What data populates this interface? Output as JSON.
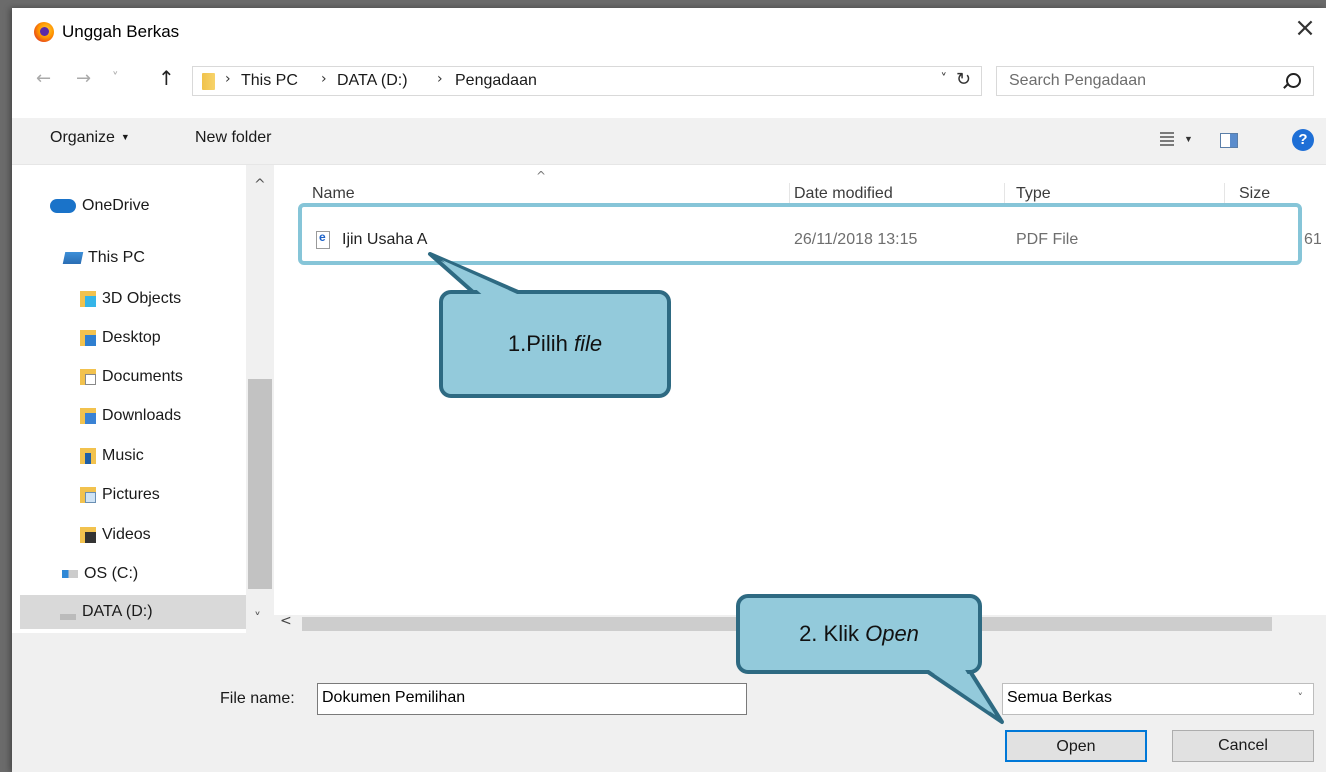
{
  "window": {
    "title": "Unggah Berkas",
    "close_label": "×"
  },
  "nav": {
    "back_label": "←",
    "forward_label": "→",
    "history_label": "˅",
    "up_label": "↑",
    "breadcrumb": [
      "This PC",
      "DATA (D:)",
      "Pengadaan"
    ],
    "separator": "›",
    "dropdown_label": "˅",
    "refresh_label": "↻"
  },
  "search": {
    "placeholder": "Search Pengadaan"
  },
  "toolbar": {
    "organize_label": "Organize",
    "organize_caret": "▼",
    "new_folder_label": "New folder",
    "view_caret": "▼",
    "help_label": "?"
  },
  "sidebar": {
    "items": [
      {
        "label": "OneDrive",
        "icon": "onedrive-icon"
      },
      {
        "label": "This PC",
        "icon": "pc-icon"
      },
      {
        "label": "3D Objects",
        "icon": "folder-3d-icon"
      },
      {
        "label": "Desktop",
        "icon": "folder-desktop-icon"
      },
      {
        "label": "Documents",
        "icon": "folder-documents-icon"
      },
      {
        "label": "Downloads",
        "icon": "folder-downloads-icon"
      },
      {
        "label": "Music",
        "icon": "folder-music-icon"
      },
      {
        "label": "Pictures",
        "icon": "folder-pictures-icon"
      },
      {
        "label": "Videos",
        "icon": "folder-videos-icon"
      },
      {
        "label": "OS (C:)",
        "icon": "drive-os-icon"
      },
      {
        "label": "DATA (D:)",
        "icon": "drive-data-icon",
        "selected": true
      }
    ],
    "scroll_up": "^",
    "scroll_down": "˅"
  },
  "columns": {
    "name": "Name",
    "date": "Date modified",
    "type": "Type",
    "size": "Size",
    "sort_caret": "^"
  },
  "files": [
    {
      "name": "Ijin Usaha A",
      "date": "26/11/2018 13:15",
      "type": "PDF File",
      "size": "61",
      "icon": "pdf-file-icon"
    }
  ],
  "hscroll": {
    "left_label": "<"
  },
  "footer": {
    "file_name_label": "File name:",
    "file_name_value": "Dokumen Pemilihan",
    "file_type_value": "Semua Berkas",
    "file_type_caret": "˅",
    "open_label": "Open",
    "cancel_label": "Cancel"
  },
  "callouts": {
    "step1_prefix": "1.Pilih ",
    "step1_em": "file",
    "step2_prefix": "2. Klik ",
    "step2_em": "Open"
  },
  "colors": {
    "callout_fill": "#93cadb",
    "callout_border": "#2e6a82",
    "highlight": "#86c5d8",
    "accent": "#0078d7"
  }
}
